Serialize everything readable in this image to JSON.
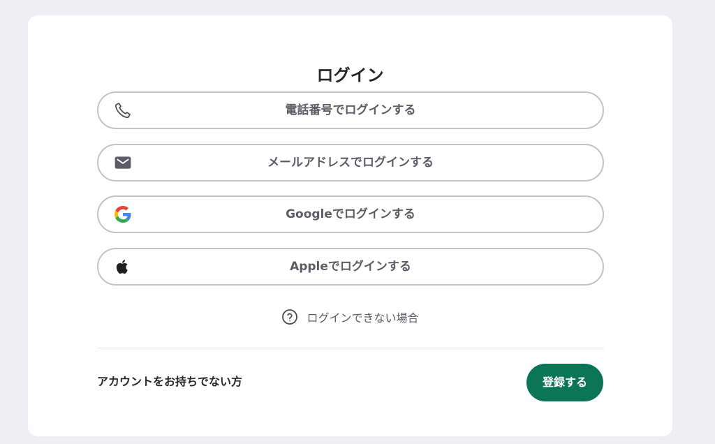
{
  "title": "ログイン",
  "login_options": [
    {
      "label": "電話番号でログインする",
      "icon": "phone-icon"
    },
    {
      "label": "メールアドレスでログインする",
      "icon": "mail-icon"
    },
    {
      "label": "Googleでログインする",
      "icon": "google-icon"
    },
    {
      "label": "Appleでログインする",
      "icon": "apple-icon"
    }
  ],
  "help": {
    "label": "ログインできない場合",
    "icon": "question-circle-icon"
  },
  "footer": {
    "no_account_text": "アカウントをお持ちでない方",
    "register_label": "登録する"
  },
  "colors": {
    "background": "#efeff3",
    "card": "#ffffff",
    "primary": "#0b7556",
    "button_border": "#c2c2c8",
    "text": "#26262b",
    "muted_text": "#5c5c66"
  }
}
